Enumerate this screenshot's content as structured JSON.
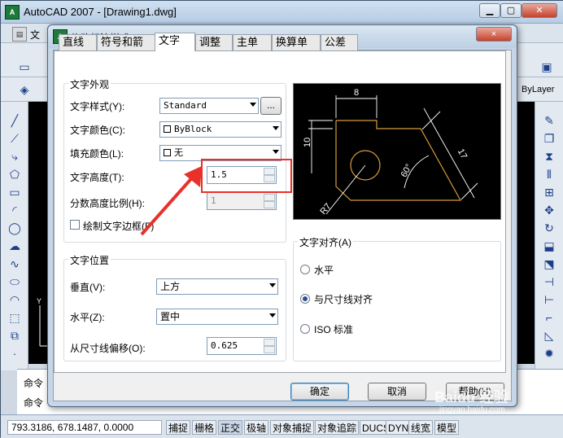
{
  "app": {
    "title": "AutoCAD 2007 - [Drawing1.dwg]",
    "logo_text": "A",
    "menu_stub": "文",
    "right_label": "ByLayer",
    "command_lines": [
      "命令",
      "命令"
    ]
  },
  "status": {
    "coords": "793.3186, 678.1487, 0.0000",
    "toggles": [
      "捕捉",
      "栅格",
      "正交",
      "极轴",
      "对象捕捉",
      "对象追踪",
      "DUCS",
      "DYN",
      "线宽",
      "模型"
    ]
  },
  "dialog": {
    "title": "修改标注样式: ISO-25",
    "close_icon": "×",
    "tabs": [
      "直线",
      "符号和箭头",
      "文字",
      "调整",
      "主单位",
      "换算单位",
      "公差"
    ],
    "active_tab": "文字",
    "appearance": {
      "group_label": "文字外观",
      "style_label": "文字样式(Y):",
      "style_value": "Standard",
      "style_browse": "...",
      "color_label": "文字颜色(C):",
      "color_value": "ByBlock",
      "fill_label": "填充颜色(L):",
      "fill_value": "无",
      "height_label": "文字高度(T):",
      "height_value": "1.5",
      "fraction_label": "分数高度比例(H):",
      "fraction_value": "1",
      "frame_label": "绘制文字边框(F)"
    },
    "placement": {
      "group_label": "文字位置",
      "vertical_label": "垂直(V):",
      "vertical_value": "上方",
      "horizontal_label": "水平(Z):",
      "horizontal_value": "置中",
      "offset_label": "从尺寸线偏移(O):",
      "offset_value": "0.625"
    },
    "alignment": {
      "group_label": "文字对齐(A)",
      "options": [
        "水平",
        "与尺寸线对齐",
        "ISO 标准"
      ],
      "selected": "与尺寸线对齐"
    },
    "preview": {
      "dim_top": "8",
      "dim_left": "10",
      "dim_slant": "17",
      "dim_angle": "60°",
      "dim_radius": "R7"
    },
    "buttons": {
      "ok": "确定",
      "cancel": "取消",
      "help": "帮助(H)"
    }
  },
  "annotation": {
    "arrow_color": "#e8312a",
    "box_color": "#e8312a"
  },
  "watermark": {
    "text": "Baidu 经验",
    "sub": "jingyan.baidu.com"
  }
}
